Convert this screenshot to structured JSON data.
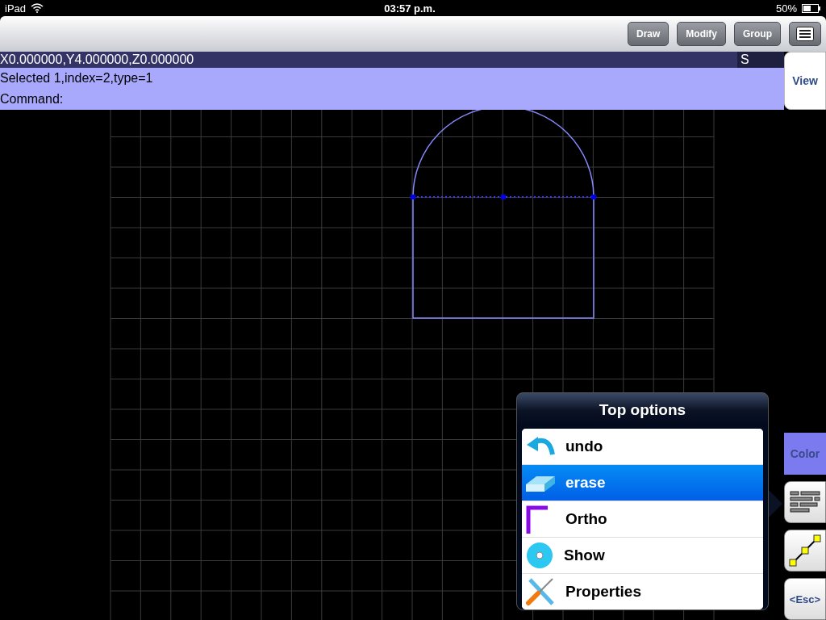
{
  "status_bar": {
    "carrier": "iPad",
    "time": "03:57 p.m.",
    "battery": "50%"
  },
  "toolbar": {
    "buttons": [
      "Draw",
      "Modify",
      "Group"
    ]
  },
  "coordinates": "X0.000000,Y4.000000,Z0.000000",
  "snap": "S",
  "info_lines": [
    "Selected 1,index=2,type=1",
    "Command:"
  ],
  "view_button": "View",
  "popover": {
    "title": "Top options",
    "items": [
      {
        "kind": "undo",
        "label": "undo",
        "selected": false
      },
      {
        "kind": "erase",
        "label": "erase",
        "selected": true
      },
      {
        "kind": "ortho",
        "label": "Ortho",
        "selected": false
      },
      {
        "kind": "show",
        "label": "Show",
        "selected": false
      },
      {
        "kind": "properties",
        "label": "Properties",
        "selected": false
      }
    ]
  },
  "side_buttons": [
    {
      "kind": "color",
      "label": "Color"
    },
    {
      "kind": "layers"
    },
    {
      "kind": "line"
    },
    {
      "kind": "esc",
      "label": "<Esc>"
    }
  ]
}
